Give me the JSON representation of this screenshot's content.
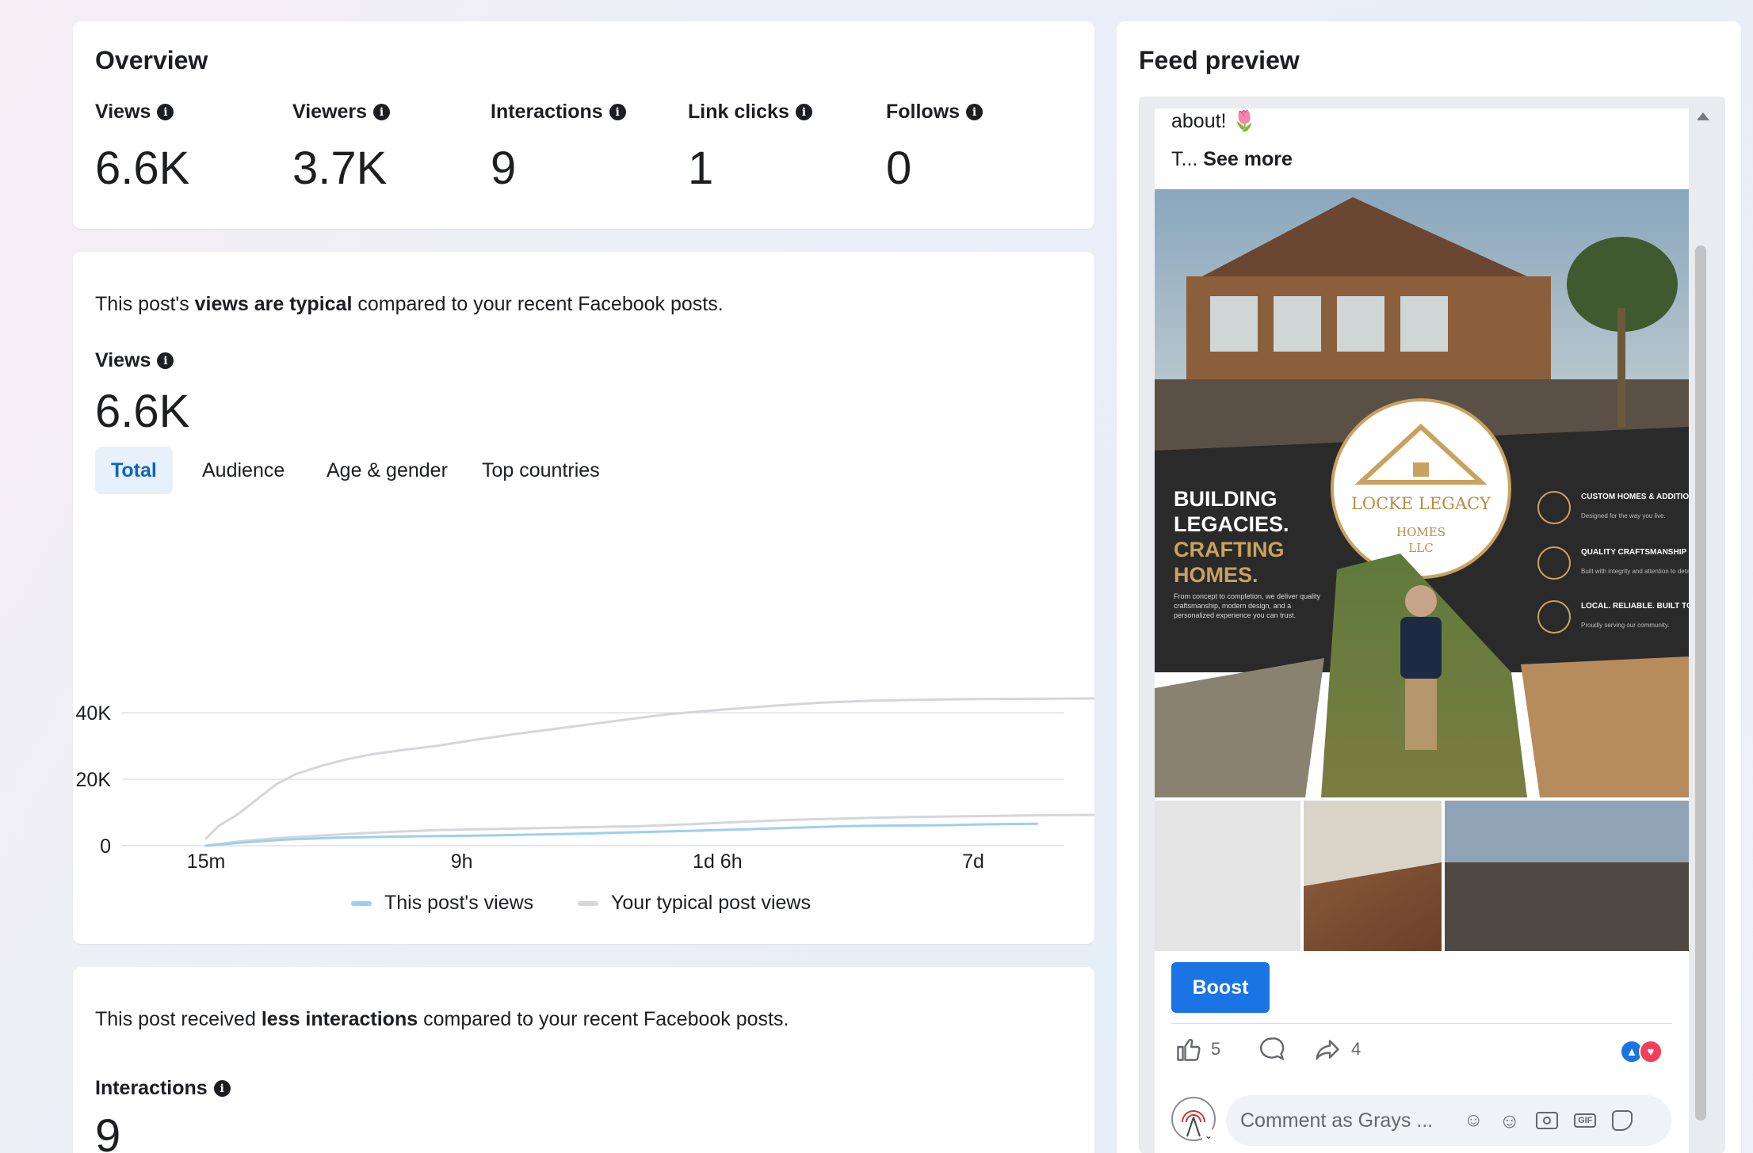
{
  "overview": {
    "title": "Overview",
    "metrics": [
      {
        "label": "Views",
        "value": "6.6K"
      },
      {
        "label": "Viewers",
        "value": "3.7K"
      },
      {
        "label": "Interactions",
        "value": "9"
      },
      {
        "label": "Link clicks",
        "value": "1"
      },
      {
        "label": "Follows",
        "value": "0"
      }
    ]
  },
  "views_card": {
    "sentence_pre": "This post's ",
    "sentence_bold": "views are typical",
    "sentence_post": " compared to your recent Facebook posts.",
    "metric_label": "Views",
    "metric_value": "6.6K",
    "tabs": [
      "Total",
      "Audience",
      "Age & gender",
      "Top countries"
    ],
    "active_tab": "Total"
  },
  "chart_data": {
    "type": "line",
    "x_ticks": [
      "15m",
      "9h",
      "1d 6h",
      "7d"
    ],
    "y_ticks": [
      "0",
      "20K",
      "40K"
    ],
    "ylim": [
      0,
      40000
    ],
    "series": [
      {
        "name": "This post's views",
        "color": "#9ccff0",
        "points": [
          [
            0,
            0
          ],
          [
            0.3,
            1000
          ],
          [
            0.6,
            1800
          ],
          [
            1,
            2400
          ],
          [
            1.4,
            2700
          ],
          [
            1.8,
            2900
          ],
          [
            2.2,
            3100
          ],
          [
            2.6,
            3400
          ],
          [
            3,
            3700
          ],
          [
            3.4,
            4100
          ],
          [
            3.8,
            4500
          ],
          [
            4.2,
            4900
          ],
          [
            4.6,
            5400
          ],
          [
            5,
            5900
          ],
          [
            5.2,
            6000
          ],
          [
            5.5,
            6100
          ],
          [
            5.8,
            6200
          ],
          [
            6.05,
            6400
          ],
          [
            6.2,
            6500
          ],
          [
            6.5,
            6600
          ]
        ]
      },
      {
        "name": "Your typical post views",
        "color": "#d5d6d9",
        "points": [
          [
            0,
            0
          ],
          [
            0.3,
            1500
          ],
          [
            0.6,
            2400
          ],
          [
            1,
            3300
          ],
          [
            1.4,
            4100
          ],
          [
            1.8,
            4700
          ],
          [
            2.2,
            5000
          ],
          [
            2.6,
            5300
          ],
          [
            3,
            5600
          ],
          [
            3.4,
            5900
          ],
          [
            3.8,
            6500
          ],
          [
            4.2,
            7200
          ],
          [
            4.6,
            7800
          ],
          [
            5,
            8200
          ],
          [
            5.2,
            8400
          ],
          [
            5.6,
            8700
          ],
          [
            6,
            8900
          ],
          [
            6.4,
            9100
          ],
          [
            7,
            9300
          ],
          [
            7.6,
            9300
          ]
        ]
      },
      {
        "name": "Your typical post views (upper)",
        "color": "#d5d6d9",
        "points": [
          [
            0,
            2200
          ],
          [
            0.1,
            6000
          ],
          [
            0.25,
            9500
          ],
          [
            0.4,
            14000
          ],
          [
            0.55,
            18500
          ],
          [
            0.7,
            21500
          ],
          [
            0.9,
            24000
          ],
          [
            1.1,
            26000
          ],
          [
            1.3,
            27500
          ],
          [
            1.5,
            28600
          ],
          [
            1.8,
            30000
          ],
          [
            2.1,
            31800
          ],
          [
            2.4,
            33500
          ],
          [
            2.7,
            35000
          ],
          [
            3,
            36500
          ],
          [
            3.3,
            38000
          ],
          [
            3.6,
            39500
          ],
          [
            4,
            40800
          ],
          [
            4.4,
            42000
          ],
          [
            4.8,
            43000
          ],
          [
            5.2,
            43600
          ],
          [
            5.6,
            43900
          ],
          [
            6,
            44100
          ],
          [
            6.5,
            44200
          ],
          [
            7,
            44300
          ],
          [
            7.6,
            44300
          ]
        ]
      }
    ]
  },
  "legend": {
    "this_post": "This post's views",
    "typical": "Your typical post views"
  },
  "interactions_card": {
    "sentence_pre": "This post received ",
    "sentence_bold": "less interactions",
    "sentence_post": " compared to your recent Facebook posts.",
    "metric_label": "Interactions",
    "metric_value": "9"
  },
  "feed_preview": {
    "title": "Feed preview",
    "caption_line1": "about!",
    "caption_emoji": "🌷",
    "caption_line2_prefix": "T... ",
    "see_more": "See more",
    "flyer": {
      "headline_white1": "BUILDING",
      "headline_white2": "LEGACIES.",
      "headline_gold1": "CRAFTING",
      "headline_gold2": "HOMES.",
      "blurb": "From concept to completion, we deliver quality craftsmanship, modern design, and a personalized experience you can trust.",
      "logo_name": "LOCKE LEGACY",
      "logo_sub1": "HOMES",
      "logo_sub2": "LLC",
      "features": [
        {
          "title": "CUSTOM HOMES & ADDITIONS",
          "desc": "Designed for the way you live."
        },
        {
          "title": "QUALITY CRAFTSMANSHIP",
          "desc": "Built with integrity and attention to detail."
        },
        {
          "title": "LOCAL. RELIABLE. BUILT TO LAST.",
          "desc": "Proudly serving our community."
        }
      ]
    },
    "boost_label": "Boost",
    "like_count": "5",
    "share_count": "4",
    "comment_placeholder": "Comment as Grays ..."
  }
}
